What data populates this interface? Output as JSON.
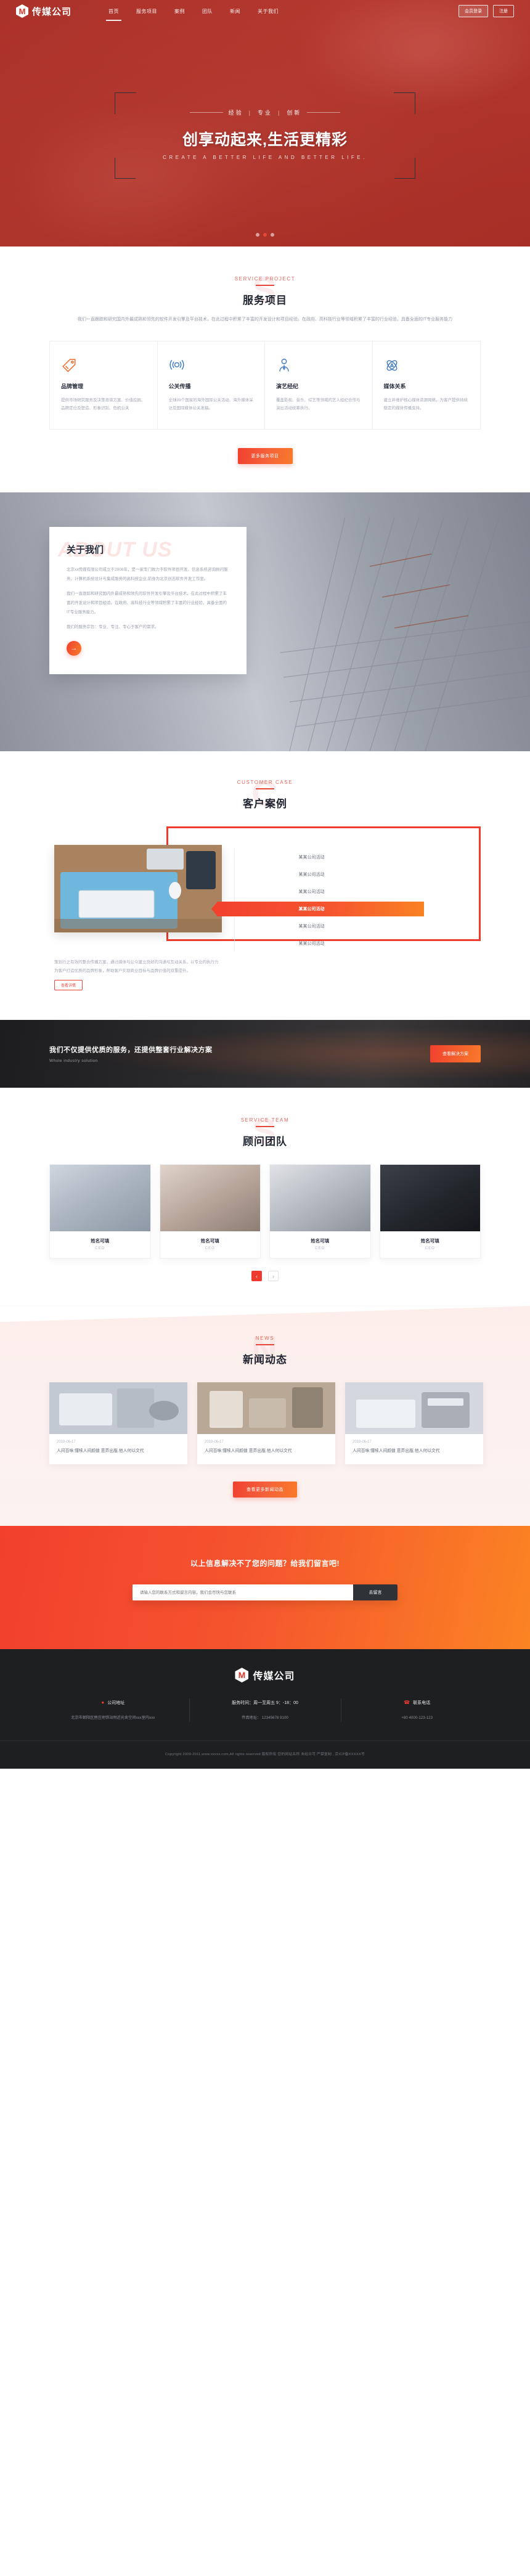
{
  "brand": {
    "mark_letter": "M",
    "name": "传媒公司"
  },
  "nav": {
    "links": [
      {
        "label": "首页",
        "active": true
      },
      {
        "label": "服务项目",
        "active": false
      },
      {
        "label": "案例",
        "active": false
      },
      {
        "label": "团队",
        "active": false
      },
      {
        "label": "新闻",
        "active": false
      },
      {
        "label": "关于我们",
        "active": false
      }
    ],
    "login_label": "会员登录",
    "register_label": "注册"
  },
  "hero": {
    "kicker_1": "经验",
    "kicker_2": "专业",
    "kicker_3": "创新",
    "title": "创享动起来,生活更精彩",
    "subtitle": "CREATE A BETTER LIFE AND BETTER LIFE.",
    "dots": [
      "1",
      "2",
      "3"
    ],
    "active_dot": 1
  },
  "services": {
    "en": "SERVICE PROJECT",
    "cn": "服务项目",
    "watermark": "S",
    "desc": "我们一直跟踪和研究国内外最成熟和领先的软件开发引擎及平台技术，在此过程中积累了丰富的开发设计和项目经验。在政府、高科技行业等领域积累了丰富的行业经验，具备全面的IT专业服务能力",
    "cards": [
      {
        "icon": "price-tag-icon",
        "title": "品牌管理",
        "text": "提供市场研究服务及决策咨询方案、价值挖掘、品牌定位及塑造、形象识别、危机公关"
      },
      {
        "icon": "broadcast-icon",
        "title": "公关传播",
        "text": "全球39个国家的海外国际公关活动、海外媒体采访及国际媒体公关发稿。"
      },
      {
        "icon": "person-tie-icon",
        "title": "演艺经纪",
        "text": "覆盖影视、音乐、综艺等领域的艺人经纪合作与演出活动统筹执行。"
      },
      {
        "icon": "atom-icon",
        "title": "媒体关系",
        "text": "建立并维护核心媒体资源网络，为客户提供持续稳定的媒体传播支持。"
      }
    ],
    "button": "更多服务项目"
  },
  "about": {
    "watermark": "ABOUT US",
    "title": "关于我们",
    "paragraphs": [
      "北京xx传媒有限公司成立于2008年，是一家专门致力于软件项目开发、信息系统咨询顾问服务、计算机系统设计与集成服务的高科技企业,前身为北京创志软件开发工作室。",
      "我们一直跟踪和研究国内外最成熟和领先的软件开发引擎及平台技术，在此过程中积累了丰富的开发设计和项目经验。在政府、高科技行业等领域积累了丰富的行业经验，具备全面的IT专业服务能力。",
      "我们的服务宗旨：专业、专注、专心于客户的需求。"
    ],
    "more_icon": "arrow-right-icon"
  },
  "cases": {
    "en": "CUSTOMER CASE",
    "cn": "客户案例",
    "watermark": "C",
    "items": [
      {
        "label": "某某公司活动",
        "active": false
      },
      {
        "label": "某某公司活动",
        "active": false
      },
      {
        "label": "某某公司活动",
        "active": false
      },
      {
        "label": "某某公司活动",
        "active": true
      },
      {
        "label": "某某公司活动",
        "active": false
      },
      {
        "label": "某某公司活动",
        "active": false
      }
    ],
    "caption": "策划行之有效的整合传播方案，通过媒体与公众建立良好的沟通与互动关系，以专业的执行力为客户打造优质的品牌形象，帮助客户实现商业目标与品牌价值的双重提升。",
    "more_label": "查看详情"
  },
  "solution": {
    "cn": "我们不仅提供优质的服务，还提供整套行业解决方案",
    "en": "Whole industry solution",
    "button": "查看解决方案"
  },
  "team": {
    "en": "SERVICE TEAM",
    "cn": "顾问团队",
    "watermark": "S",
    "members": [
      {
        "name": "姓名可填",
        "role": "CEO",
        "photo": "ph-p1"
      },
      {
        "name": "姓名可填",
        "role": "CEO",
        "photo": "ph-p2"
      },
      {
        "name": "姓名可填",
        "role": "CEO",
        "photo": "ph-p3"
      },
      {
        "name": "姓名可填",
        "role": "CEO",
        "photo": "ph-p4"
      }
    ],
    "prev_icon": "chevron-left-icon",
    "next_icon": "chevron-right-icon"
  },
  "news": {
    "en": "NEWS",
    "cn": "新闻动态",
    "watermark": "N",
    "items": [
      {
        "date": "2019-06-17",
        "title": "人间百味;懂嗦人间颜值 意弄出版,他人何以文代",
        "photo": "ph-n1"
      },
      {
        "date": "2019-06-17",
        "title": "人间百味;懂嗦人间颜值 意弄出版,他人何以文代",
        "photo": "ph-n2"
      },
      {
        "date": "2019-06-17",
        "title": "人间百味;懂嗦人间颜值 意弄出版,他人何以文代",
        "photo": "ph-n3"
      }
    ],
    "button": "查看更多新闻动态"
  },
  "contact": {
    "title": "以上信息解决不了您的问题？给我们留言吧!",
    "placeholder": "请输入您的联系方式和留言内容，我们会尽快与您联系",
    "submit": "去留言"
  },
  "footer": {
    "brand_name": "传媒公司",
    "mark_letter": "M",
    "columns": [
      {
        "icon": "location-pin-icon",
        "head": "公司地址",
        "line": "北京市朝阳区替庄地铁站附近光舍空间xxx室内xxx"
      },
      {
        "icon": "",
        "head": "服务时间：周一至周五 9：-18：00",
        "line": "传真地址：  12345678 9100"
      },
      {
        "icon": "phone-icon",
        "head": "联系电话",
        "line": "+80 4000-123-123"
      }
    ],
    "copyright": "Copyright 2009-2011,www.xxxxx.com,All rights reserved 版权所有 您的网站名称 未经许可 严禁复制 , 京ICP备XXXXX号"
  }
}
